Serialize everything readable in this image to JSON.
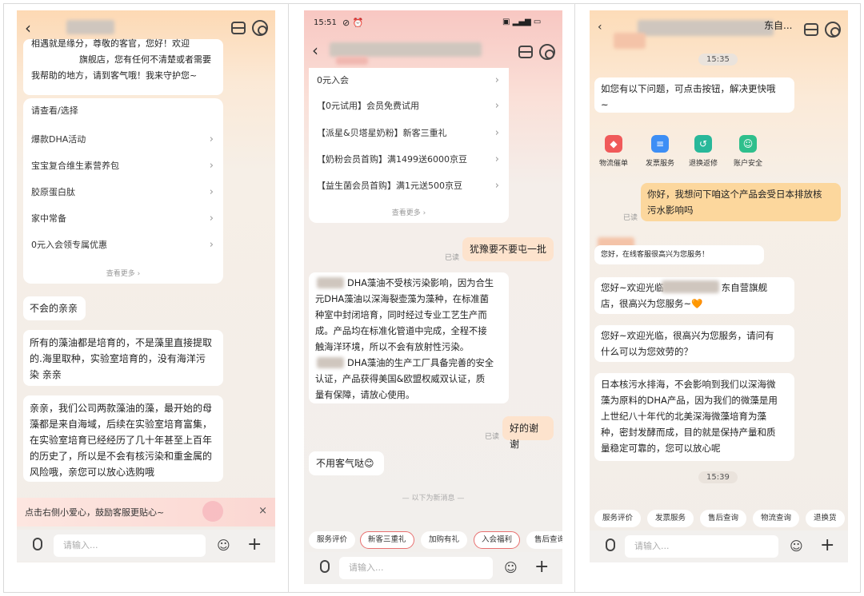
{
  "p1": {
    "greeting": "相遇就是缘分，尊敬的客官，您好！欢迎",
    "greeting2": "旗舰店，您有任何不清楚或者需要",
    "greeting3": "我帮助的地方，请到客气哦！我来守护您~",
    "menu_title": "请查看/选择",
    "menu": [
      "爆款DHA活动",
      "宝宝复合维生素营养包",
      "胶原蛋白肽",
      "家中常备",
      "0元入会领专属优惠"
    ],
    "more": "查看更多 ›",
    "msg1": "不会的亲亲",
    "msg2": [
      "所有的藻油都是培育的，不是藻里直接提取",
      "的.海里取种，实验室培育的，没有海洋污",
      "染    亲亲"
    ],
    "msg3": [
      "亲亲，我们公司两款藻油的藻，最开始的母",
      "藻都是来自海域，后续在实验室培育富集，",
      "在实验室培育已经经历了几十年甚至上百年",
      "的历史了，所以是不会有核污染和重金属的",
      "风险哦，亲您可以放心选购哦"
    ],
    "tip": "点击右侧小爱心，鼓励客服更贴心~",
    "input_placeholder": "请输入..."
  },
  "p2": {
    "time": "15:51",
    "menu": [
      "0元入会",
      "【0元试用】会员免费试用",
      "【派星&贝塔星奶粉】新客三重礼",
      "【奶粉会员首购】满1499送6000京豆",
      "【益生菌会员首购】满1元送500京豆"
    ],
    "more": "查看更多 ›",
    "me1": "犹豫要不要屯一批",
    "read": "已读",
    "reply": [
      "DHA藻油不受核污染影响，因为合生",
      "元DHA藻油以深海裂壶藻为藻种，在标准菌",
      "种室中封闭培育，同时经过专业工艺生产而",
      "成。产品均在标准化管道中完成，全程不接",
      "触海洋环境，所以不会有放射性污染。",
      "DHA藻油的生产工厂具备完善的安全",
      "认证，产品获得美国&欧盟权威双认证，质",
      "量有保障，请放心使用。"
    ],
    "me2": "好的谢谢",
    "reply2": "不用客气哒😊",
    "divider": "以下为新消息",
    "chips": [
      "服务评价",
      "新客三重礼",
      "加购有礼",
      "入会福利",
      "售后查询"
    ],
    "input_placeholder": "请输入..."
  },
  "p3": {
    "title_tail": "东自...",
    "time1": "15:35",
    "intro": [
      "如您有以下问题，可点击按钮，解决更快哦",
      "~"
    ],
    "services": [
      "物流催单",
      "发票服务",
      "退换返修",
      "账户安全"
    ],
    "me": [
      "你好，我想问下咱这个产品会受日本排放核",
      "污水影响吗"
    ],
    "read": "已读",
    "agent_tag": "您好，在线客服很高兴为您服务！",
    "welcome": [
      "您好~欢迎光临",
      "东自营旗舰",
      "店，很高兴为您服务~🧡"
    ],
    "welcome2": [
      "您好~欢迎光临，很高兴为您服务，请问有",
      "什么可以为您效劳的？"
    ],
    "answer": [
      "日本核污水排海，不会影响到我们以深海微",
      "藻为原料的DHA产品，因为我们的微藻是用",
      "上世纪八十年代的北美深海微藻培育为藻",
      "种，密封发酵而成，目的就是保持产量和质",
      "量稳定可靠的，您可以放心呢"
    ],
    "time2": "15:39",
    "chips": [
      "服务评价",
      "发票服务",
      "售后查询",
      "物流查询",
      "退换货"
    ],
    "input_placeholder": "请输入..."
  },
  "colors": {
    "service_red": "#f05a5a",
    "service_blue": "#3d8ef5",
    "service_teal": "#28b89a",
    "service_green": "#2fbf8c"
  }
}
